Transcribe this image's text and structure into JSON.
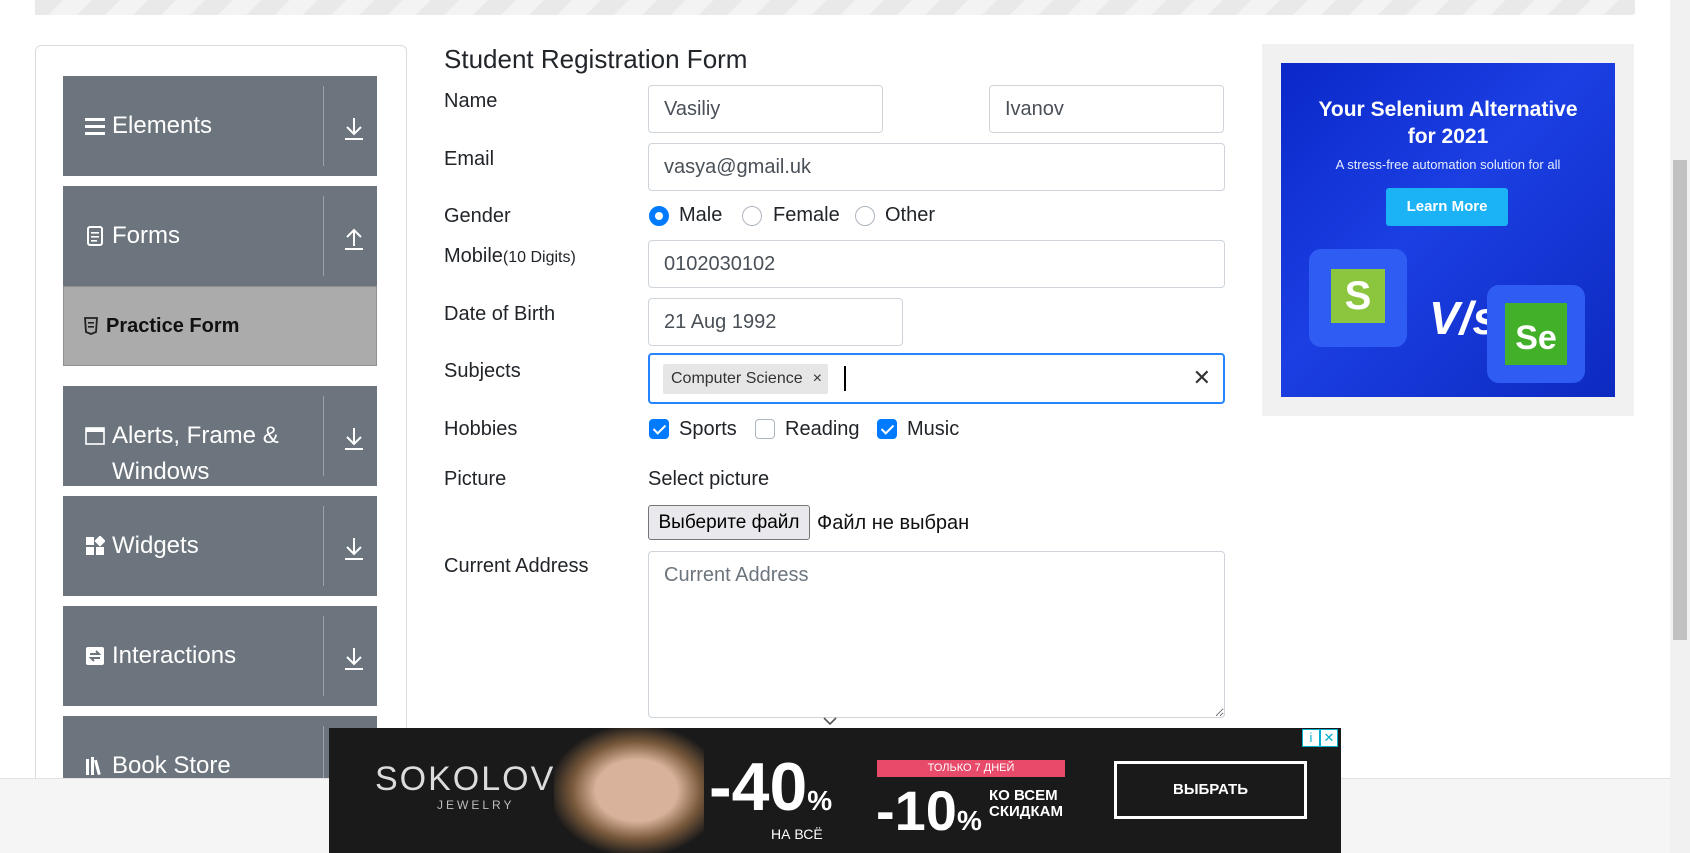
{
  "sidebar": {
    "groups": [
      {
        "label": "Elements",
        "icon": "hamburger-icon",
        "arrow": "download-arrow-icon"
      },
      {
        "label": "Forms",
        "icon": "form-doc-icon",
        "arrow": "upload-arrow-icon"
      },
      {
        "label": "Alerts, Frame &",
        "label2": "Windows",
        "icon": "window-icon",
        "arrow": "download-arrow-icon"
      },
      {
        "label": "Widgets",
        "icon": "widgets-icon",
        "arrow": "download-arrow-icon"
      },
      {
        "label": "Interactions",
        "icon": "interactions-icon",
        "arrow": "download-arrow-icon"
      },
      {
        "label": "Book Store",
        "icon": "books-icon",
        "arrow": "download-arrow-icon"
      }
    ],
    "active_item": {
      "label": "Practice Form",
      "icon": "html5-icon"
    }
  },
  "form": {
    "title": "Student Registration Form",
    "name_label": "Name",
    "first_name": "Vasiliy",
    "last_name": "Ivanov",
    "email_label": "Email",
    "email": "vasya@gmail.uk",
    "gender_label": "Gender",
    "gender_options": [
      "Male",
      "Female",
      "Other"
    ],
    "gender_selected": "Male",
    "mobile_label": "Mobile",
    "mobile_hint": "(10 Digits)",
    "mobile": "0102030102",
    "dob_label": "Date of Birth",
    "dob": "21 Aug 1992",
    "subjects_label": "Subjects",
    "subject_tag": "Computer Science",
    "tag_remove": "×",
    "clear_symbol": "✕",
    "hobbies_label": "Hobbies",
    "hobbies": [
      {
        "label": "Sports",
        "checked": true
      },
      {
        "label": "Reading",
        "checked": false
      },
      {
        "label": "Music",
        "checked": true
      }
    ],
    "picture_label": "Picture",
    "select_picture": "Select picture",
    "file_button": "Выберите файл",
    "file_status": "Файл не выбран",
    "address_label": "Current Address",
    "address_placeholder": "Current Address"
  },
  "side_ad": {
    "headline_1": "Your Selenium Alternative",
    "headline_2": "for 2021",
    "subline": "A stress-free automation solution for all",
    "button": "Learn More",
    "vs": "V/s",
    "logo_left": "S",
    "logo_right": "Se"
  },
  "banner": {
    "brand": "SOKOLOV",
    "brand_sub": "JEWELRY",
    "discount_1": "-40",
    "discount_1_sub": "НА ВСЁ",
    "ribbon": "ТОЛЬКО 7 ДНЕЙ",
    "discount_2": "-10",
    "percent": "%",
    "discount_2_sub_1": "КО ВСЕМ",
    "discount_2_sub_2": "СКИДКАМ",
    "cta": "ВЫБРАТЬ",
    "info_icon": "i",
    "close_icon": "✕"
  },
  "colors": {
    "sidebar_group": "#6c757d",
    "sidebar_active": "#ababab",
    "accent": "#007bff",
    "focus_border": "#2684ff"
  }
}
